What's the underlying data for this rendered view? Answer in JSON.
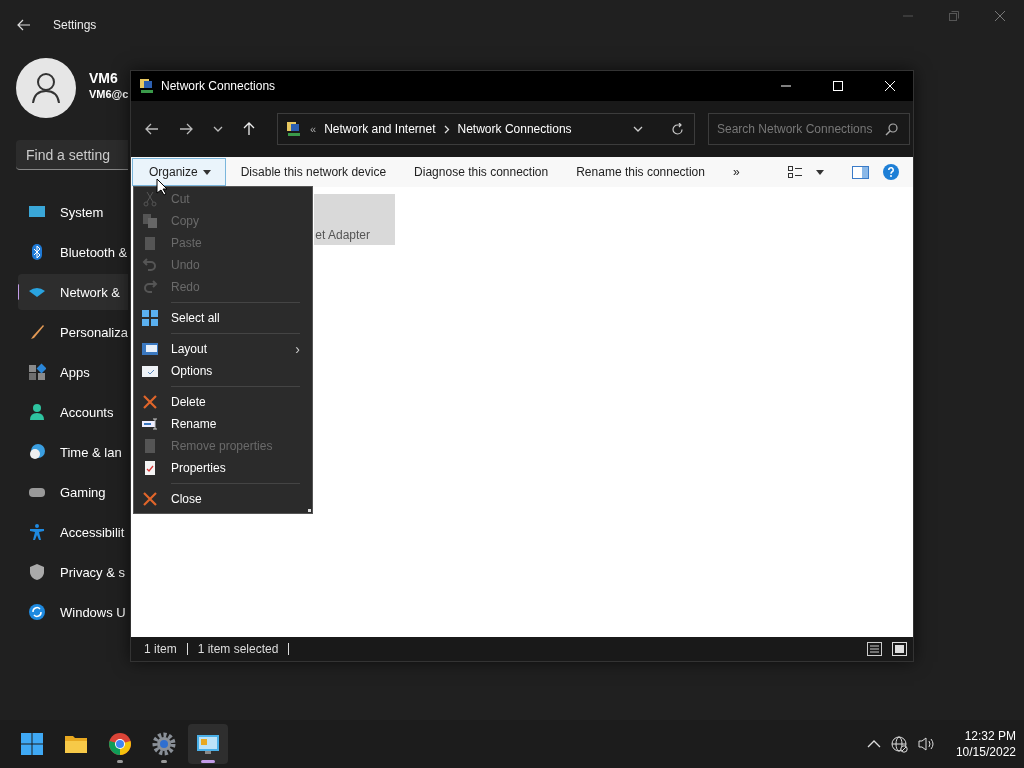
{
  "settings": {
    "title": "Settings",
    "user": {
      "name": "VM6",
      "email": "VM6@c"
    },
    "search": {
      "placeholder": "Find a setting"
    },
    "nav": [
      {
        "label": "System",
        "selected": false
      },
      {
        "label": "Bluetooth &",
        "selected": false
      },
      {
        "label": "Network &",
        "selected": true
      },
      {
        "label": "Personaliza",
        "selected": false
      },
      {
        "label": "Apps",
        "selected": false
      },
      {
        "label": "Accounts",
        "selected": false
      },
      {
        "label": "Time & lan",
        "selected": false
      },
      {
        "label": "Gaming",
        "selected": false
      },
      {
        "label": "Accessibilit",
        "selected": false
      },
      {
        "label": "Privacy & s",
        "selected": false
      },
      {
        "label": "Windows U",
        "selected": false
      }
    ]
  },
  "window": {
    "title": "Network Connections",
    "address": {
      "prefix": "«",
      "path": [
        "Network and Internet",
        "Network Connections"
      ]
    },
    "search": {
      "placeholder": "Search Network Connections"
    },
    "commands": [
      {
        "label": "Organize",
        "selected": true,
        "kind": "dropdown"
      },
      {
        "label": "Disable this network device",
        "selected": false,
        "kind": "plain"
      },
      {
        "label": "Diagnose this connection",
        "selected": false,
        "kind": "plain"
      },
      {
        "label": "Rename this connection",
        "selected": false,
        "kind": "plain"
      },
      {
        "label": "»",
        "selected": false,
        "kind": "plain"
      }
    ],
    "items": [
      {
        "label": "et Adapter",
        "selected": true
      }
    ],
    "menu": [
      {
        "kind": "item",
        "label": "Cut",
        "disabled": true
      },
      {
        "kind": "item",
        "label": "Copy",
        "disabled": true
      },
      {
        "kind": "item",
        "label": "Paste",
        "disabled": true
      },
      {
        "kind": "item",
        "label": "Undo",
        "disabled": true
      },
      {
        "kind": "item",
        "label": "Redo",
        "disabled": true
      },
      {
        "kind": "separator"
      },
      {
        "kind": "item",
        "label": "Select all",
        "disabled": false
      },
      {
        "kind": "separator"
      },
      {
        "kind": "submenu",
        "label": "Layout",
        "disabled": false,
        "arrow": "›"
      },
      {
        "kind": "item",
        "label": "Options",
        "disabled": false
      },
      {
        "kind": "separator"
      },
      {
        "kind": "item",
        "label": "Delete",
        "disabled": false
      },
      {
        "kind": "item",
        "label": "Rename",
        "disabled": false
      },
      {
        "kind": "item",
        "label": "Remove properties",
        "disabled": true
      },
      {
        "kind": "item",
        "label": "Properties",
        "disabled": false
      },
      {
        "kind": "separator"
      },
      {
        "kind": "item",
        "label": "Close",
        "disabled": false
      }
    ],
    "status": [
      "1 item",
      "1 item selected"
    ]
  },
  "taskbar": {
    "apps": [
      {
        "selected": false,
        "running": false
      },
      {
        "selected": false,
        "running": false
      },
      {
        "selected": false,
        "running": true
      },
      {
        "selected": false,
        "running": true
      },
      {
        "selected": true,
        "running": true
      }
    ],
    "time": "12:32 PM",
    "date": "10/15/2022"
  }
}
